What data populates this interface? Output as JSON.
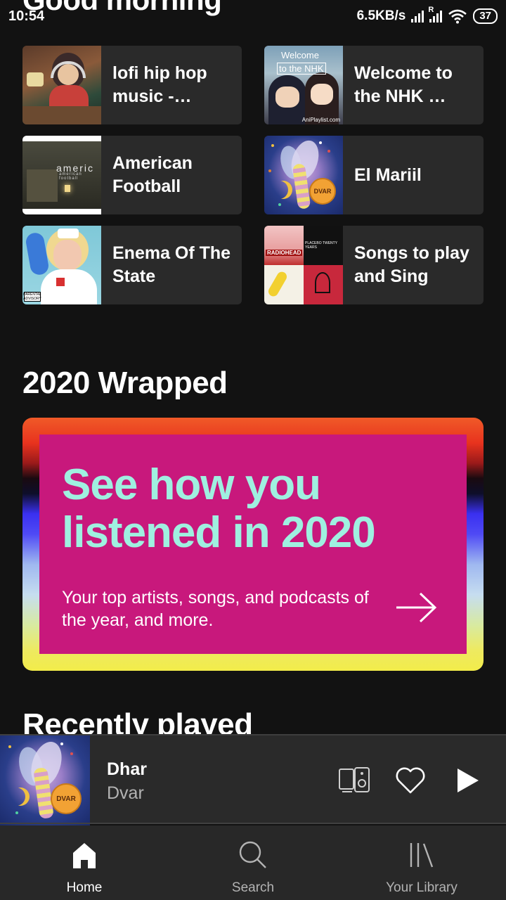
{
  "status_bar": {
    "time": "10:54",
    "net_speed": "6.5KB/s",
    "roaming_indicator": "R",
    "battery": "37"
  },
  "header": {
    "greeting": "Good morning"
  },
  "quick_picks": [
    {
      "title": "lofi hip hop music - beats…",
      "art": "lofi-cover"
    },
    {
      "title": "Welcome to the NHK …",
      "art": "nhk-cover",
      "art_text_1": "Welcome",
      "art_text_2": "to the NHK",
      "art_watermark": "AniPlaylist.com"
    },
    {
      "title": "American Football",
      "art": "american-football-cover",
      "art_text": "americ",
      "art_subtext": "american football"
    },
    {
      "title": "El Mariil",
      "art": "dvar-cover",
      "art_badge": "DVAR"
    },
    {
      "title": "Enema Of The State",
      "art": "blink-182-cover",
      "art_label": "PARENTAL ADVISORY"
    },
    {
      "title": "Songs to play and Sing",
      "art": "playlist-mosaic-cover",
      "art_text_1": "RADIOHEAD",
      "art_text_2": "PLACEBO TWENTY YEARS"
    }
  ],
  "wrapped": {
    "section_title": "2020 Wrapped",
    "headline": "See how you listened in 2020",
    "subtitle": "Your top artists, songs, and podcasts of the year, and more.",
    "colors": {
      "inner_background": "#c8187c",
      "headline_color": "#9ff0e0"
    }
  },
  "recently_played": {
    "section_title": "Recently played"
  },
  "mini_player": {
    "track": "Dhar",
    "artist": "Dvar",
    "art_badge": "DVAR",
    "icons": [
      "devices-icon",
      "heart-icon",
      "play-icon"
    ]
  },
  "bottom_nav": {
    "items": [
      {
        "label": "Home",
        "icon": "home-icon",
        "active": true
      },
      {
        "label": "Search",
        "icon": "search-icon",
        "active": false
      },
      {
        "label": "Your Library",
        "icon": "library-icon",
        "active": false
      }
    ]
  },
  "colors": {
    "background": "#121212",
    "tile": "#2a2a2a",
    "nav": "#282828",
    "secondary_text": "#b3b3b3"
  }
}
